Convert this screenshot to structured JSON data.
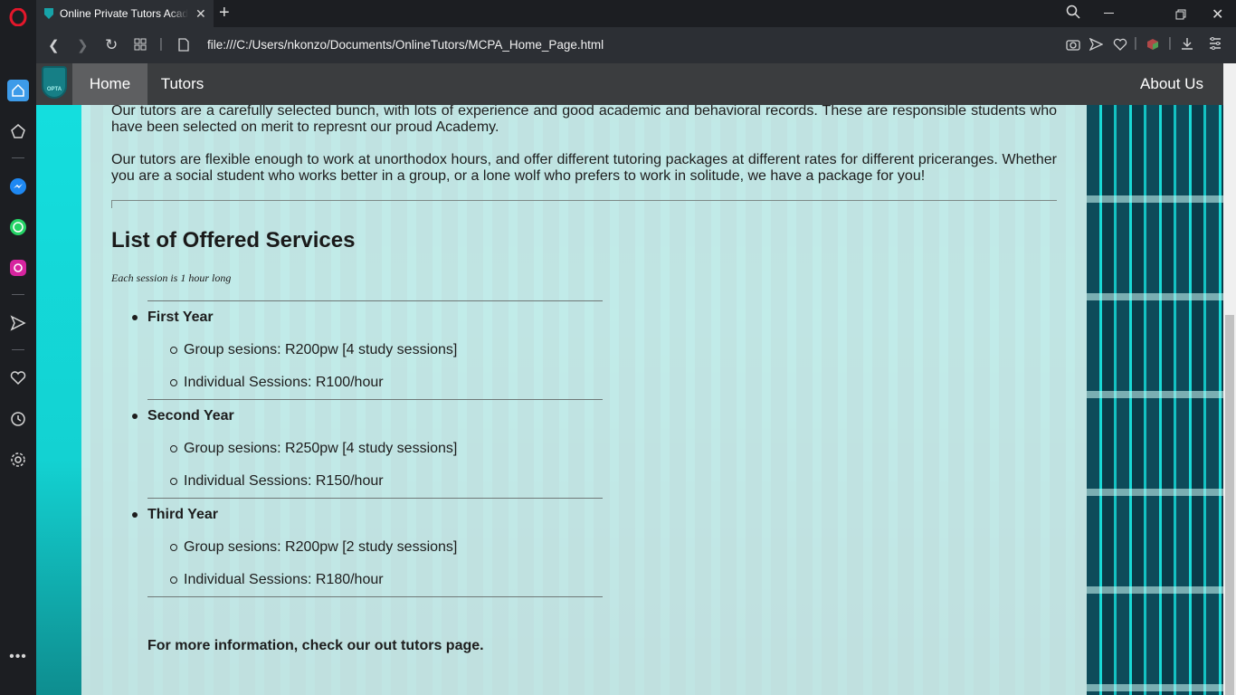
{
  "browser": {
    "tab_title": "Online Private Tutors Academy",
    "url": "file:///C:/Users/nkonzo/Documents/OnlineTutors/MCPA_Home_Page.html",
    "accent_color": "#e5172b"
  },
  "nav": {
    "logo_text": "OPTA",
    "home": "Home",
    "tutors": "Tutors",
    "about": "About Us"
  },
  "content": {
    "para1": "Our tutors are a carefully selected bunch, with lots of experience and good academic and behavioral records. These are responsible students who have been selected on merit to represnt our proud Academy.",
    "para2": "Our tutors are flexible enough to work at unorthodox hours, and offer different tutoring packages at different rates for different priceranges. Whether you are a social student who works better in a group, or a lone wolf who prefers to work in solitude, we have a package for you!",
    "services_title": "List of Offered Services",
    "session_note": "Each session is 1 hour long",
    "years": [
      {
        "name": "First Year",
        "group": "Group sesions: R200pw [4 study sessions]",
        "individual": "Individual Sessions: R100/hour"
      },
      {
        "name": "Second Year",
        "group": "Group sesions: R250pw [4 study sessions]",
        "individual": "Individual Sessions: R150/hour"
      },
      {
        "name": "Third Year",
        "group": "Group sesions: R200pw [2 study sessions]",
        "individual": "Individual Sessions: R180/hour"
      }
    ],
    "more_info": "For more information, check our out tutors page."
  }
}
